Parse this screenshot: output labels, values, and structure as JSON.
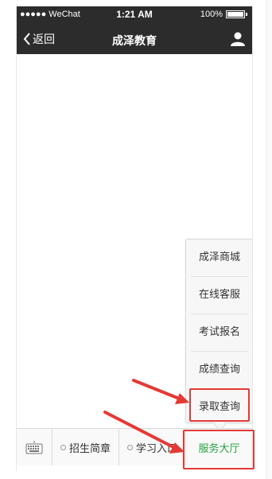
{
  "status_bar": {
    "carrier": "●●●●● WeChat",
    "time": "1:21 AM",
    "battery": "100%"
  },
  "nav": {
    "back_label": "返回",
    "title": "成泽教育",
    "user_icon": "user-icon"
  },
  "popup_menu": {
    "items": [
      "成泽商城",
      "在线客服",
      "考试报名",
      "成绩查询",
      "录取查询"
    ]
  },
  "menu_bar": {
    "keyboard_icon": "keyboard-icon",
    "items": [
      {
        "label": "招生简章"
      },
      {
        "label": "学习入口"
      },
      {
        "label": "服务大厅"
      }
    ]
  },
  "colors": {
    "nav_bg": "#2c2c2c",
    "active_menu": "#25a244",
    "annotation": "#e53935"
  }
}
